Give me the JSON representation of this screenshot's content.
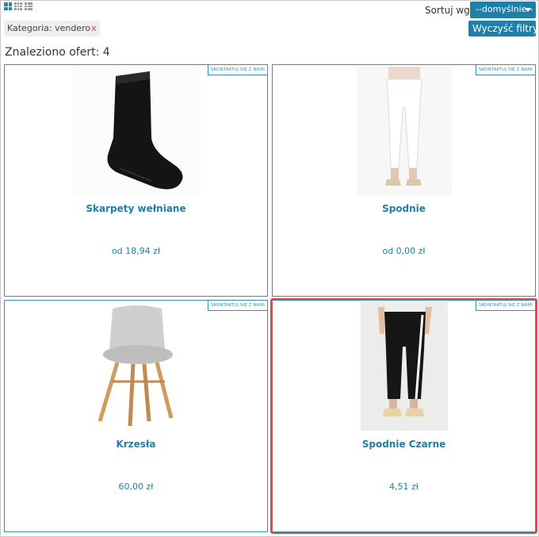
{
  "toolbar": {
    "sort_label": "Sortuj wg:",
    "sort_value": "--domyślnie--",
    "clear_filters": "Wyczyść filtry x"
  },
  "filter_chip": {
    "label": "Kategoria: vendero",
    "remove": "x"
  },
  "results": {
    "found_text": "Znaleziono ofert: 4"
  },
  "products": [
    {
      "name": "Skarpety wełniane",
      "price": "od 18,94 zł",
      "contact": "SKONTAKTUJ SIĘ Z NAMI",
      "image": "sock-image"
    },
    {
      "name": "Spodnie",
      "price": "od 0,00 zł",
      "contact": "SKONTAKTUJ SIĘ Z NAMI",
      "image": "white-pants-image"
    },
    {
      "name": "Krzesła",
      "price": "60,00 zł",
      "contact": "SKONTAKTUJ SIĘ Z NAMI",
      "image": "chair-image"
    },
    {
      "name": "Spodnie Czarne",
      "price": "4,51 zł",
      "contact": "SKONTAKTUJ SIĘ Z NAMI",
      "image": "black-pants-image"
    }
  ],
  "colors": {
    "accent": "#1f7fa8",
    "card_border": "#3a8fb3",
    "highlight": "#e04848",
    "remove_x": "#e0452a"
  }
}
